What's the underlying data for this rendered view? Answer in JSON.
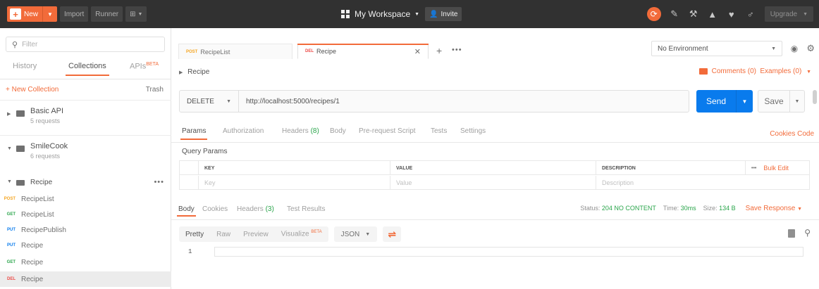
{
  "topbar": {
    "new_label": "New",
    "import_label": "Import",
    "runner_label": "Runner",
    "workspace_label": "My Workspace",
    "invite_label": "Invite",
    "upgrade_label": "Upgrade"
  },
  "sidebar": {
    "filter_placeholder": "Filter",
    "tabs": [
      "History",
      "Collections",
      "APIs"
    ],
    "apis_badge": "BETA",
    "new_collection": "+ New Collection",
    "trash": "Trash",
    "collections": [
      {
        "name": "Basic API",
        "count": "5 requests"
      },
      {
        "name": "SmileCook",
        "count": "6 requests"
      }
    ],
    "folder": "Recipe",
    "requests": [
      {
        "method": "POST",
        "name": "RecipeList",
        "color": "#f5a623"
      },
      {
        "method": "GET",
        "name": "RecipeList",
        "color": "#2aa54b"
      },
      {
        "method": "PUT",
        "name": "RecipePublish",
        "color": "#097bed"
      },
      {
        "method": "PUT",
        "name": "Recipe",
        "color": "#097bed"
      },
      {
        "method": "GET",
        "name": "Recipe",
        "color": "#2aa54b"
      },
      {
        "method": "DEL",
        "name": "Recipe",
        "color": "#ed4b48"
      }
    ]
  },
  "request_tabs": [
    {
      "method": "POST",
      "name": "RecipeList",
      "color": "#f5a623"
    },
    {
      "method": "DEL",
      "name": "Recipe",
      "color": "#ed4b48"
    }
  ],
  "environment": "No Environment",
  "breadcrumb": "Recipe",
  "comments": "Comments (0)",
  "examples": "Examples (0)",
  "url": {
    "method": "DELETE",
    "value": "http://localhost:5000/recipes/1"
  },
  "send_label": "Send",
  "save_label": "Save",
  "subtabs": {
    "params": "Params",
    "authorization": "Authorization",
    "headers": "Headers",
    "headers_count": "(8)",
    "body": "Body",
    "prerequest": "Pre-request Script",
    "tests": "Tests",
    "settings": "Settings"
  },
  "cookies_code": "Cookies  Code",
  "query_params_label": "Query Params",
  "query_table": {
    "headers": [
      "KEY",
      "VALUE",
      "DESCRIPTION"
    ],
    "placeholders": [
      "Key",
      "Value",
      "Description"
    ],
    "more": "•••",
    "bulk_edit": "Bulk Edit"
  },
  "response": {
    "tabs": {
      "body": "Body",
      "cookies": "Cookies",
      "headers": "Headers",
      "headers_count": "(3)",
      "test_results": "Test Results"
    },
    "status_label": "Status:",
    "status_value": "204 NO CONTENT",
    "time_label": "Time:",
    "time_value": "30ms",
    "size_label": "Size:",
    "size_value": "134 B",
    "save_response": "Save Response"
  },
  "format": {
    "pretty": "Pretty",
    "raw": "Raw",
    "preview": "Preview",
    "visualize": "Visualize",
    "visualize_badge": "BETA",
    "json": "JSON"
  },
  "editor": {
    "line_number": "1"
  },
  "colors": {
    "accent": "#f26b3a",
    "send": "#097bed",
    "status_ok": "#2aa54b"
  }
}
